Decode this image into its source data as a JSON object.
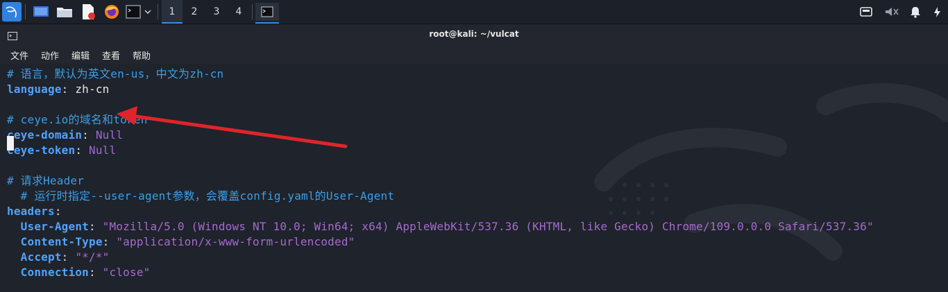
{
  "taskbar": {
    "workspaces": [
      "1",
      "2",
      "3",
      "4"
    ],
    "active_workspace": "1",
    "icons": [
      "kali-menu-icon",
      "desktop-icon",
      "file-manager-icon",
      "text-editor-icon",
      "firefox-icon",
      "terminal-icon",
      "chevron-down-icon",
      "network-icon",
      "volume-muted-icon",
      "notifications-icon",
      "power-icon"
    ]
  },
  "window": {
    "title": "root@kali: ~/vulcat",
    "menu": [
      "文件",
      "动作",
      "编辑",
      "查看",
      "帮助"
    ]
  },
  "terminal": {
    "lines": [
      {
        "comment": "# 语言，默认为英文en-us，中文为zh-cn"
      },
      {
        "key": "language",
        "sep": ": ",
        "value": "zh-cn",
        "value_style": "plain"
      },
      {
        "cursor": true
      },
      {
        "comment": "# ceye.io的域名和token"
      },
      {
        "key": "ceye-domain",
        "sep": ": ",
        "value": "Null",
        "value_style": "null"
      },
      {
        "key": "ceye-token",
        "sep": ": ",
        "value": "Null",
        "value_style": "null"
      },
      {
        "blank": true
      },
      {
        "comment": "# 请求Header"
      },
      {
        "comment": "  # 运行时指定--user-agent参数，会覆盖config.yaml的User-Agent"
      },
      {
        "key": "headers",
        "sep": ":"
      },
      {
        "indent": "  ",
        "key": "User-Agent",
        "sep": ": ",
        "value": "\"Mozilla/5.0 (Windows NT 10.0; Win64; x64) AppleWebKit/537.36 (KHTML, like Gecko) Chrome/109.0.0.0 Safari/537.36\"",
        "value_style": "str"
      },
      {
        "indent": "  ",
        "key": "Content-Type",
        "sep": ": ",
        "value": "\"application/x-www-form-urlencoded\"",
        "value_style": "str"
      },
      {
        "indent": "  ",
        "key": "Accept",
        "sep": ": ",
        "value": "\"*/*\"",
        "value_style": "str"
      },
      {
        "indent": "  ",
        "key": "Connection",
        "sep": ": ",
        "value": "\"close\"",
        "value_style": "str"
      }
    ]
  },
  "colors": {
    "comment": "#3d9ee6",
    "key": "#4fa3ff",
    "string": "#a66ad0",
    "annotation_arrow": "#e0242b"
  }
}
